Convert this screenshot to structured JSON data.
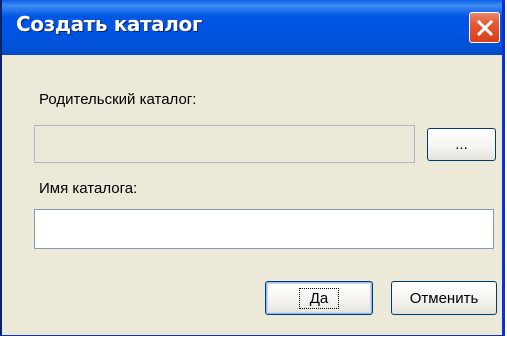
{
  "window": {
    "title": "Создать каталог",
    "close_icon": "close-icon"
  },
  "form": {
    "parent_label": "Родительский каталог:",
    "parent_value": "",
    "browse_label": "...",
    "name_label": "Имя каталога:",
    "name_value": ""
  },
  "buttons": {
    "ok_label": "Да",
    "cancel_label": "Отменить"
  },
  "colors": {
    "titlebar": "#0054e3",
    "close_button": "#e4572f",
    "dialog_face": "#ece9d8",
    "field_border": "#7f9db9"
  }
}
